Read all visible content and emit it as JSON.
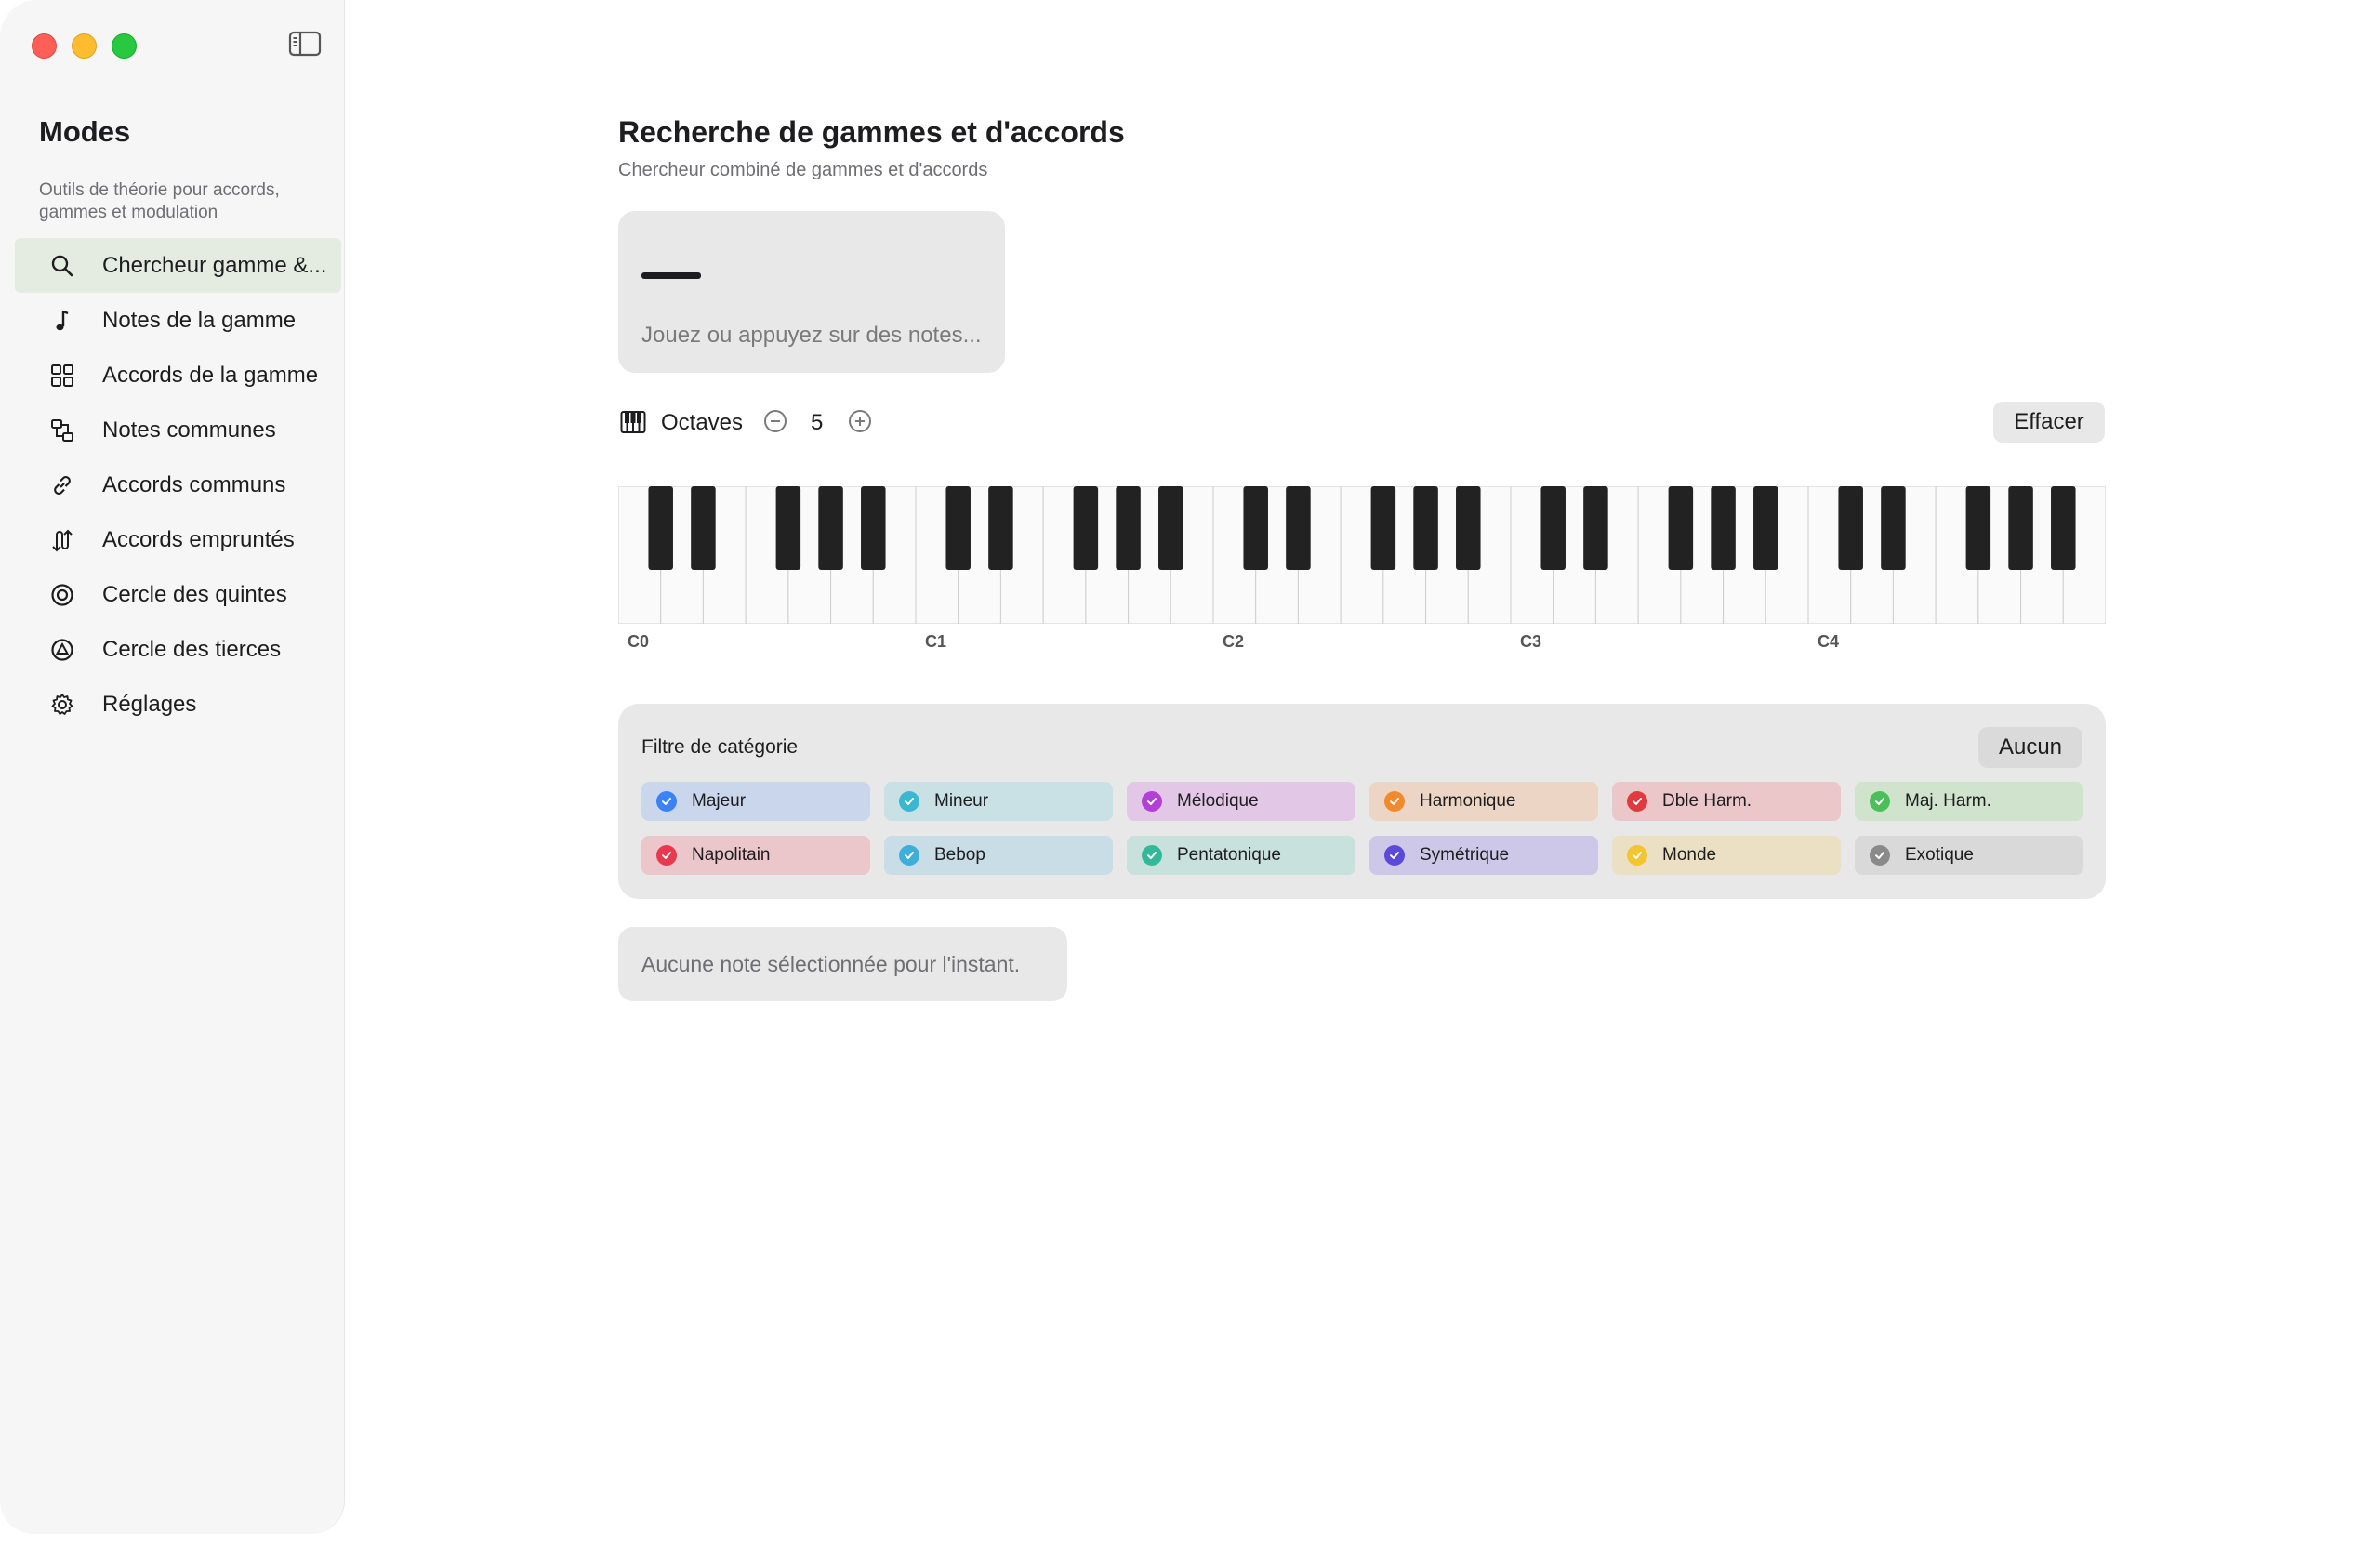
{
  "sidebar": {
    "title": "Modes",
    "subtitle": "Outils de théorie pour accords, gammes et modulation",
    "items": [
      {
        "label": "Chercheur gamme &...",
        "icon": "search-icon",
        "active": true
      },
      {
        "label": "Notes de la gamme",
        "icon": "music-note-icon",
        "active": false
      },
      {
        "label": "Accords de la gamme",
        "icon": "grid-icon",
        "active": false
      },
      {
        "label": "Notes communes",
        "icon": "compare-icon",
        "active": false
      },
      {
        "label": "Accords communs",
        "icon": "link-icon",
        "active": false
      },
      {
        "label": "Accords empruntés",
        "icon": "borrow-arrows-icon",
        "active": false
      },
      {
        "label": "Cercle des quintes",
        "icon": "circle-icon",
        "active": false
      },
      {
        "label": "Cercle des tierces",
        "icon": "triangle-circle-icon",
        "active": false
      },
      {
        "label": "Réglages",
        "icon": "gear-icon",
        "active": false
      }
    ]
  },
  "main": {
    "title": "Recherche de gammes et d'accords",
    "subtitle": "Chercheur combiné de gammes et d'accords",
    "input": {
      "placeholder": "Jouez ou appuyez sur des notes..."
    },
    "octaves": {
      "label": "Octaves",
      "value": "5"
    },
    "clear_label": "Effacer",
    "piano": {
      "octave_labels": [
        "C0",
        "C1",
        "C2",
        "C3",
        "C4"
      ]
    },
    "filter": {
      "title": "Filtre de catégorie",
      "none_label": "Aucun",
      "chips": [
        {
          "label": "Majeur",
          "color": "#3b82f6",
          "bg": "#c9d6ec"
        },
        {
          "label": "Mineur",
          "color": "#3bb7d1",
          "bg": "#c9e1e4"
        },
        {
          "label": "Mélodique",
          "color": "#b23fd6",
          "bg": "#e2c8e6"
        },
        {
          "label": "Harmonique",
          "color": "#f08a2c",
          "bg": "#ecd5c4"
        },
        {
          "label": "Dble Harm.",
          "color": "#e0393f",
          "bg": "#ebc7c9"
        },
        {
          "label": "Maj. Harm.",
          "color": "#4cbf5a",
          "bg": "#cfe3cd"
        },
        {
          "label": "Napolitain",
          "color": "#e8394e",
          "bg": "#ebc6cb"
        },
        {
          "label": "Bebop",
          "color": "#3faedb",
          "bg": "#c8dde6"
        },
        {
          "label": "Pentatonique",
          "color": "#34b89a",
          "bg": "#c8e1dc"
        },
        {
          "label": "Symétrique",
          "color": "#5b4ad8",
          "bg": "#cdc8e8"
        },
        {
          "label": "Monde",
          "color": "#f2c531",
          "bg": "#ece0c4"
        },
        {
          "label": "Exotique",
          "color": "#8a8a8a",
          "bg": "#d9d9d9"
        }
      ]
    },
    "status_text": "Aucune note sélectionnée pour l'instant."
  }
}
